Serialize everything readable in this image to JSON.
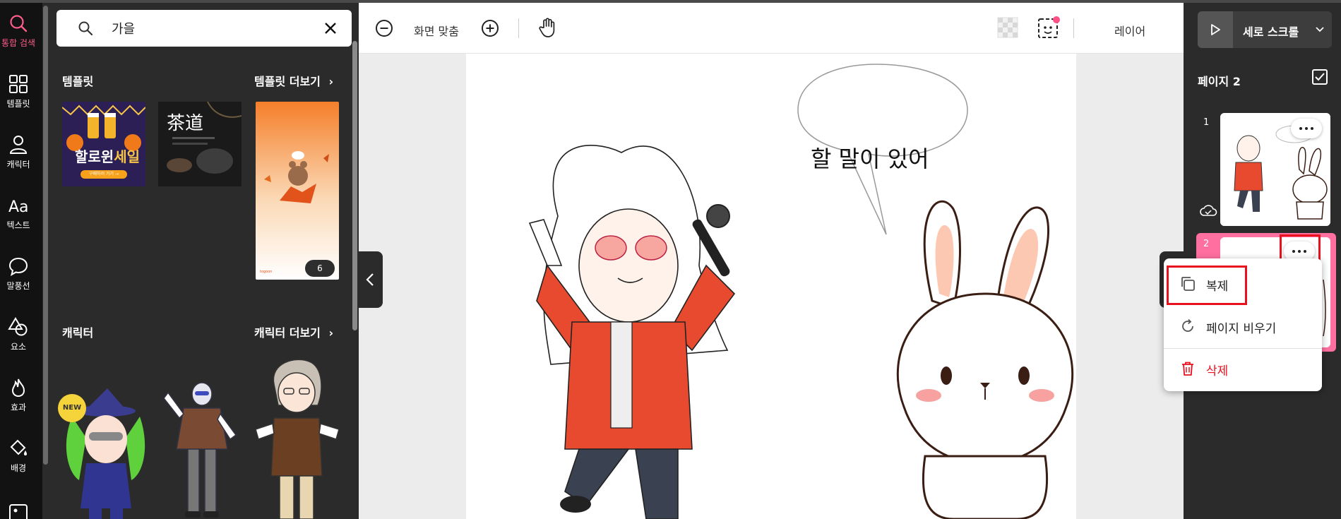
{
  "rail": {
    "items": [
      {
        "label": "통합 검색",
        "icon": "search-icon"
      },
      {
        "label": "템플릿",
        "icon": "grid-icon"
      },
      {
        "label": "캐릭터",
        "icon": "person-icon"
      },
      {
        "label": "텍스트",
        "icon": "text-icon"
      },
      {
        "label": "말풍선",
        "icon": "speech-bubble-icon"
      },
      {
        "label": "요소",
        "icon": "shapes-icon"
      },
      {
        "label": "효과",
        "icon": "flame-icon"
      },
      {
        "label": "배경",
        "icon": "paint-bucket-icon"
      }
    ],
    "active_color": "#ff5c8a"
  },
  "search": {
    "value": "가을"
  },
  "templates": {
    "title": "템플릿",
    "more": "템플릿 더보기",
    "cards": [
      {
        "headline": "할로윈",
        "accent": "세일",
        "button": "구매하러 가기 →"
      },
      {
        "headline": "茶道"
      },
      {
        "badge": "6",
        "brand": "togoon"
      }
    ]
  },
  "characters": {
    "title": "캐릭터",
    "more": "캐릭터 더보기",
    "new_badge": "NEW"
  },
  "toolbar": {
    "fit_label": "화면 맞춤",
    "layer_label": "레이어"
  },
  "canvas": {
    "bubble_text": "할 말이 있어"
  },
  "right_panel": {
    "play_label": "세로 스크롤",
    "page_title": "페이지 2",
    "pages": [
      {
        "number": "1"
      },
      {
        "number": "2",
        "selected": true
      }
    ],
    "accent_color": "#ff6fa0"
  },
  "context_menu": {
    "items": [
      {
        "label": "복제",
        "icon": "copy-icon"
      },
      {
        "label": "페이지 비우기",
        "icon": "refresh-icon"
      },
      {
        "label": "삭제",
        "icon": "trash-icon"
      }
    ],
    "highlight_color": "#e8121e"
  }
}
